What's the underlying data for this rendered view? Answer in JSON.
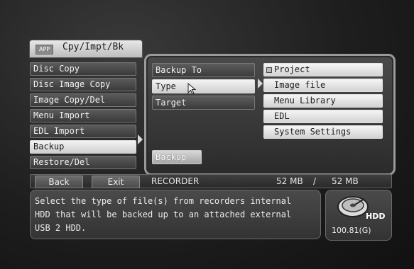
{
  "header": {
    "badge": "APP",
    "title": "Cpy/Impt/Bk"
  },
  "left_menu": [
    {
      "label": "Disc Copy",
      "active": false
    },
    {
      "label": "Disc Image Copy",
      "active": false
    },
    {
      "label": "Image Copy/Del",
      "active": false
    },
    {
      "label": "Menu Import",
      "active": false
    },
    {
      "label": "EDL Import",
      "active": false
    },
    {
      "label": "Backup",
      "active": true
    },
    {
      "label": "Restore/Del",
      "active": false
    }
  ],
  "settings": [
    {
      "label": "Backup To",
      "active": false
    },
    {
      "label": "Type",
      "active": true
    },
    {
      "label": "Target",
      "active": false
    }
  ],
  "types": [
    {
      "label": "Project",
      "checked": true
    },
    {
      "label": "Image file",
      "checked": false
    },
    {
      "label": "Menu Library",
      "checked": false
    },
    {
      "label": "EDL",
      "checked": false
    },
    {
      "label": "System Settings",
      "checked": false
    }
  ],
  "action": {
    "backup_label": "Backup"
  },
  "status_bar": {
    "back_label": "Back",
    "exit_label": "Exit",
    "source": "RECORDER",
    "size_used": "52 MB",
    "separator": "/",
    "size_total": "52 MB"
  },
  "description": "Select the type of file(s) from recorders internal\nHDD that will be backed up to an attached external\nUSB 2 HDD.",
  "hdd": {
    "label": "HDD",
    "capacity": "100.81(G)"
  }
}
